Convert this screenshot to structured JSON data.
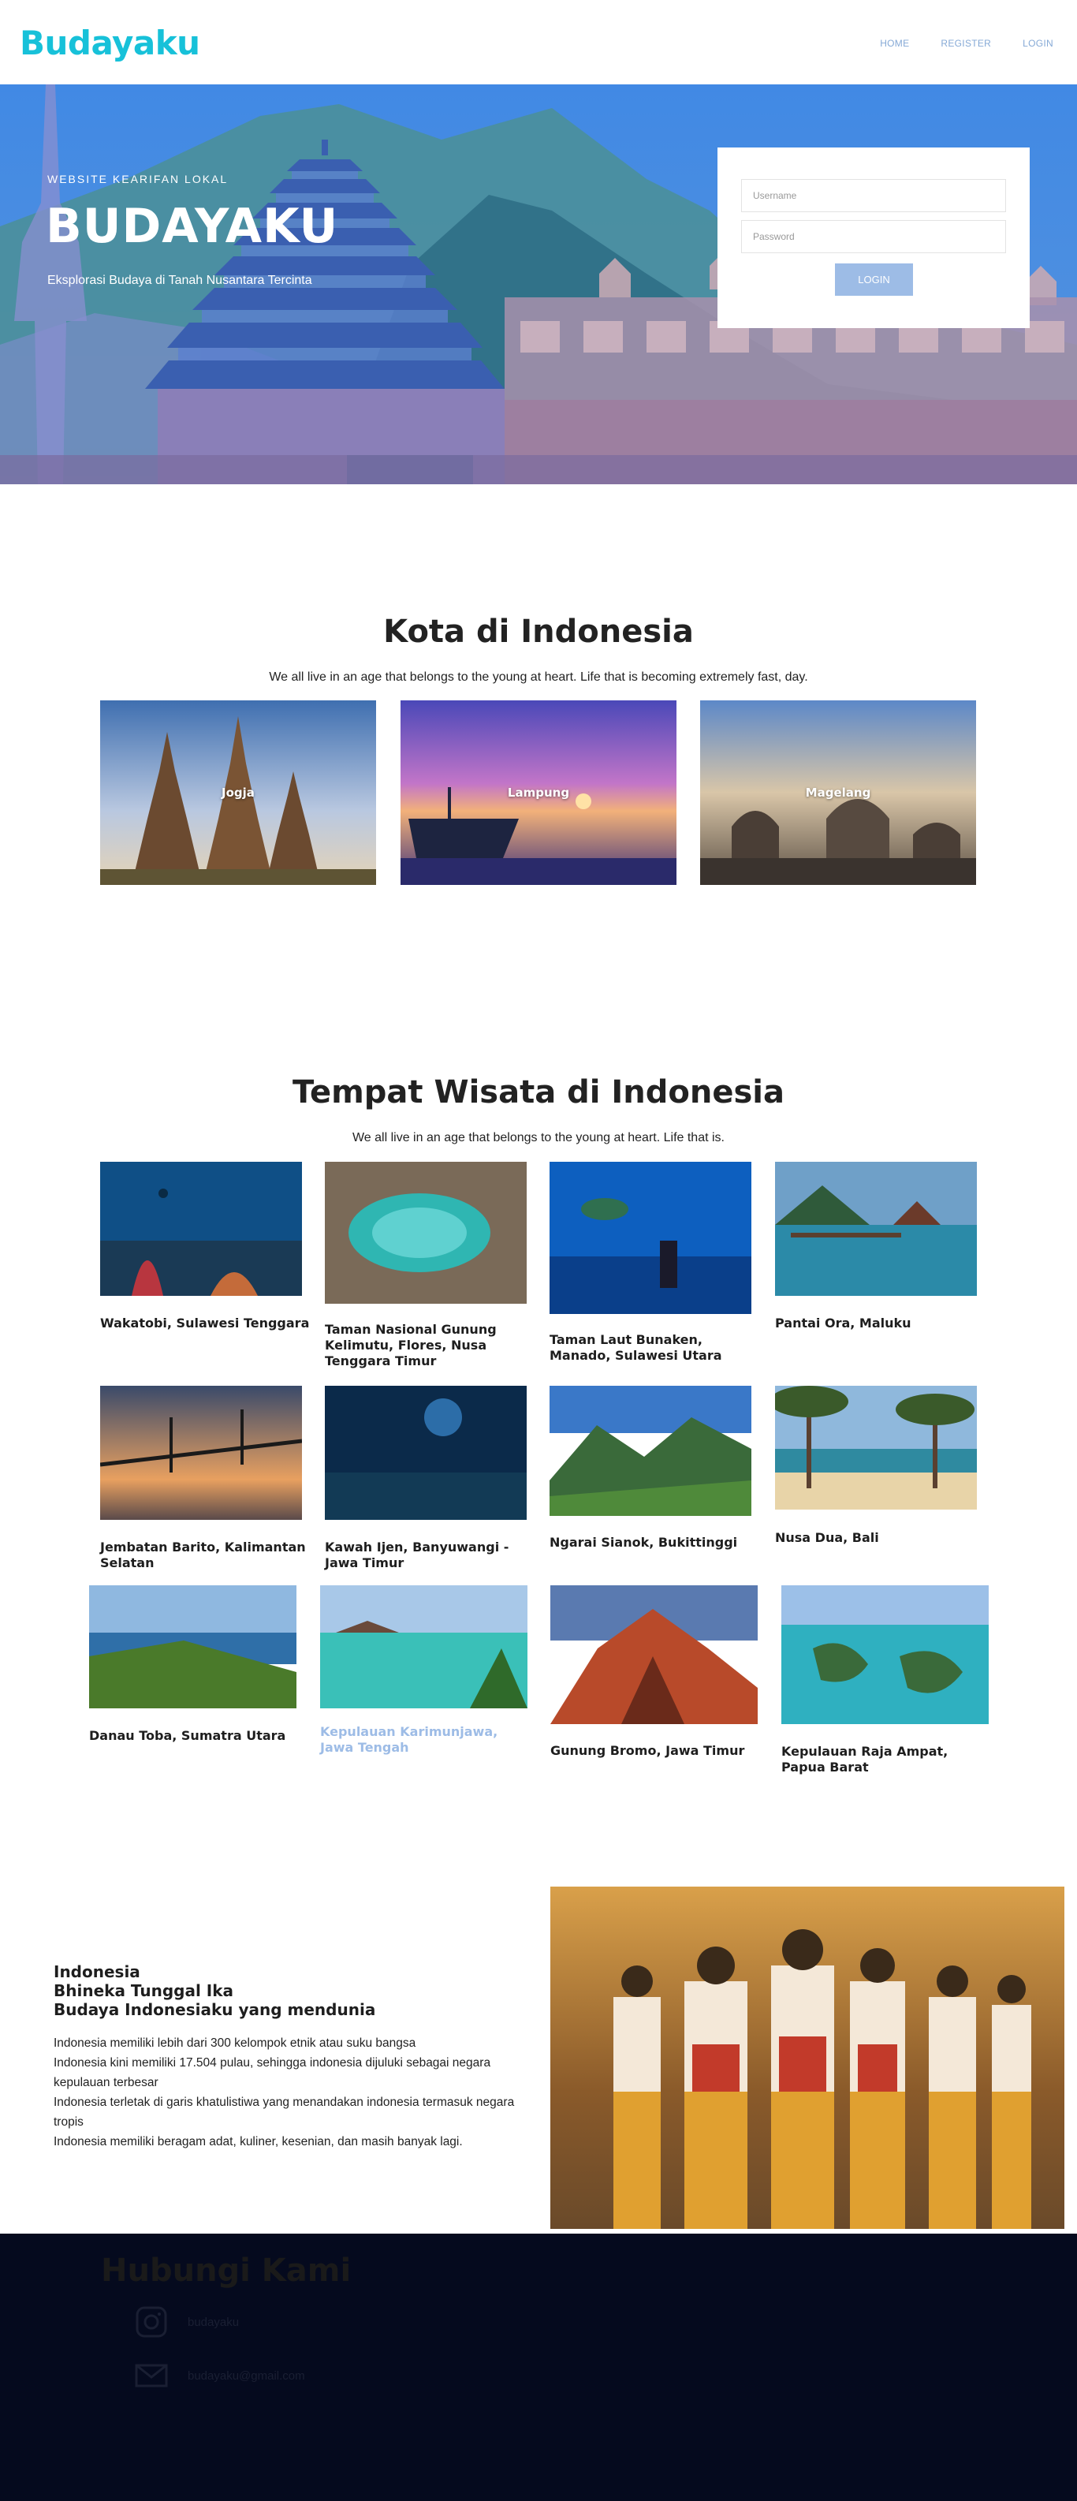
{
  "navbar": {
    "brand": "Budayaku",
    "links": [
      "HOME",
      "REGISTER",
      "LOGIN"
    ]
  },
  "hero": {
    "kicker": "WEBSITE KEARIFAN LOKAL",
    "title": "BUDAYAKU",
    "subtitle": "Eksplorasi Budaya di Tanah Nusantara Tercinta"
  },
  "login": {
    "username_placeholder": "Username",
    "password_placeholder": "Password",
    "button": "LOGIN"
  },
  "kota": {
    "title": "Kota di Indonesia",
    "subtitle": "We all live in an age that belongs to the young at heart. Life that is becoming extremely fast, day.",
    "cities": [
      "Jogja",
      "Lampung",
      "Magelang"
    ]
  },
  "wisata": {
    "title": "Tempat Wisata di Indonesia",
    "subtitle": "We all live in an age that belongs to the young at heart. Life that is.",
    "places": [
      "Wakatobi, Sulawesi Tenggara",
      "Taman Nasional Gunung Kelimutu, Flores, Nusa Tenggara Timur",
      "Taman Laut Bunaken, Manado, Sulawesi Utara",
      "Pantai Ora, Maluku",
      "Jembatan Barito, Kalimantan Selatan",
      "Kawah Ijen, Banyuwangi - Jawa Timur",
      "Ngarai Sianok, Bukittinggi",
      "Nusa Dua, Bali",
      "Danau Toba, Sumatra Utara",
      "Kepulauan Karimunjawa, Jawa Tengah",
      "Gunung Bromo, Jawa Timur",
      "Kepulauan Raja Ampat, Papua Barat"
    ]
  },
  "info": {
    "heading": [
      "Indonesia",
      "Bhineka Tunggal Ika",
      "Budaya Indonesiaku yang mendunia"
    ],
    "lines": [
      "Indonesia memiliki lebih dari 300 kelompok etnik atau suku bangsa",
      "Indonesia kini memiliki 17.504 pulau, sehingga indonesia dijuluki sebagai negara kepulauan terbesar",
      "Indonesia terletak di garis khatulistiwa yang menandakan indonesia termasuk negara tropis",
      "Indonesia memiliki beragam adat, kuliner, kesenian, dan masih banyak lagi."
    ]
  },
  "footer": {
    "title": "Hubungi Kami",
    "instagram": "budayaku",
    "email": "budayaku@gmail.com"
  },
  "colors": {
    "brand": "#17c1d9",
    "nav_link": "#85a9d6",
    "button": "#9dbce6",
    "footer_bg": "#050a1e"
  }
}
